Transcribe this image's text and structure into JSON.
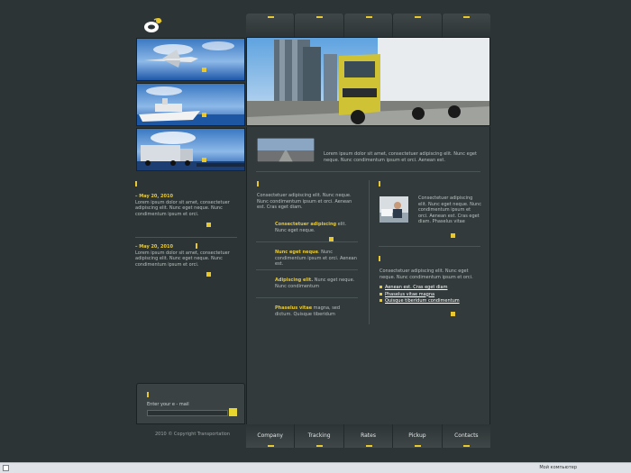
{
  "nav": [
    "",
    "",
    "",
    "",
    ""
  ],
  "bottom_nav": [
    "Company",
    "Tracking",
    "Rates",
    "Pickup",
    "Contacts"
  ],
  "left_news": [
    {
      "date": "May 20, 2010",
      "text": "Lorem ipsum dolor sit amet, consectetuer adipiscing elit. Nunc eget neque. Nunc condimentum ipsum et orci."
    },
    {
      "date": "May 20, 2010",
      "text": "Lorem ipsum dolor sit amet, consectetuer adipiscing elit. Nunc eget neque. Nunc condimentum ipsum et orci."
    }
  ],
  "featured_text": "Lorem ipsum dolor sit amet, consectetuer adipiscing elit. Nunc eget neque. Nunc condimentum ipsum et orci. Aenean est.",
  "center_intro": "Consectetuer adipiscing elit. Nunc neque. Nunc condimentum ipsum et orci. Aenean est. Cras eget diam.",
  "center_items": [
    {
      "title": "Consectetuer adipiscing",
      "rest": " elit. Nunc eget neque."
    },
    {
      "title": "Nunc eget neque",
      "rest": ". Nunc condimentum ipsum et orci. Aenean est."
    },
    {
      "title": "Adipiscing elit.",
      "rest": " Nunc eget neque. Nunc condimentum"
    },
    {
      "title": "Phaselus vitae",
      "rest": " magna, sed dictum. Quisque tiberidum"
    }
  ],
  "right_top_text": "Consectetuer adipiscing elit. Nunc eget neque. Nunc condimentum ipsum et orci. Aenean est. Cras eget diam. Phaselus vitae",
  "right_bottom_text": "Consectetuer adipiscing elit. Nunc eget neque. Nunc condimentum ipsum et orci.",
  "right_links": [
    "Aenean est. Cras eget diam",
    "Phaselus vitae magna",
    "Quisque tiberidum condimentum"
  ],
  "newsletter_label": "Enter your e - mail",
  "copyright": "2010 © Copyright Transportation",
  "status_text": "Мой компьютер"
}
